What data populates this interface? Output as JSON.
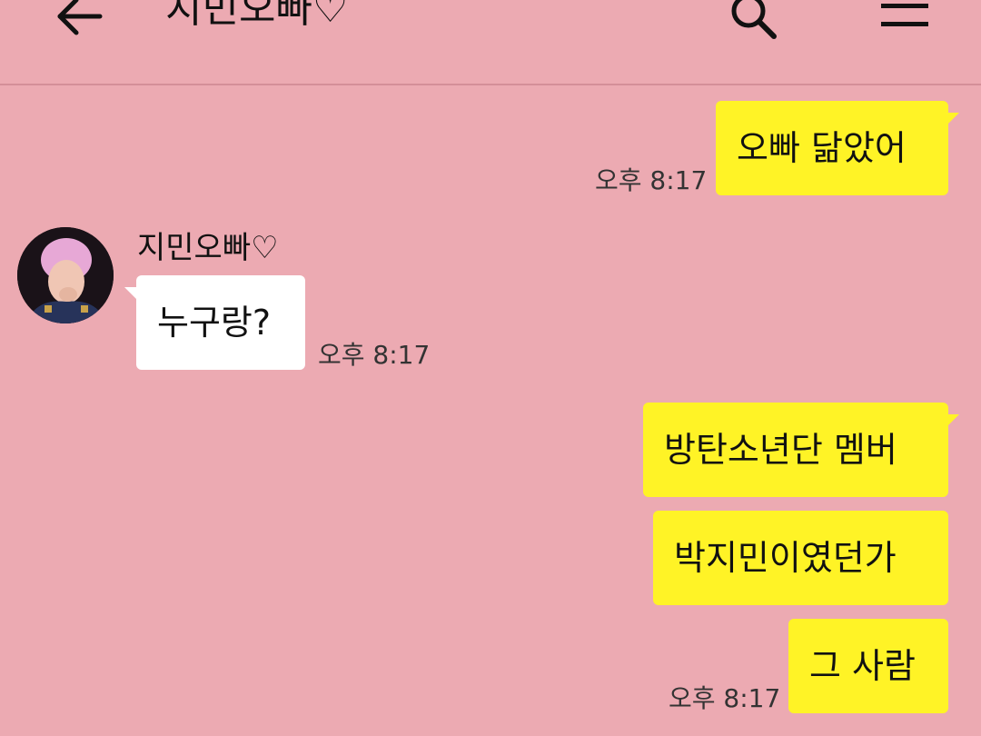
{
  "header": {
    "title": "지민오빠♡",
    "back_icon": "arrow-left-icon",
    "search_icon": "search-icon",
    "menu_icon": "hamburger-menu-icon"
  },
  "colors": {
    "background": "#ecaab2",
    "my_bubble": "#fff326",
    "their_bubble": "#ffffff"
  },
  "messages": [
    {
      "sender": "me",
      "text": "오빠 닮았어",
      "time": "오후 8:17"
    },
    {
      "sender": "지민오빠♡",
      "text": "누구랑?",
      "time": "오후 8:17"
    },
    {
      "sender": "me",
      "text": "방탄소년단 멤버"
    },
    {
      "sender": "me",
      "text": "박지민이였던가"
    },
    {
      "sender": "me",
      "text": "그 사람",
      "time": "오후 8:17"
    }
  ],
  "contact": {
    "name": "지민오빠♡"
  }
}
